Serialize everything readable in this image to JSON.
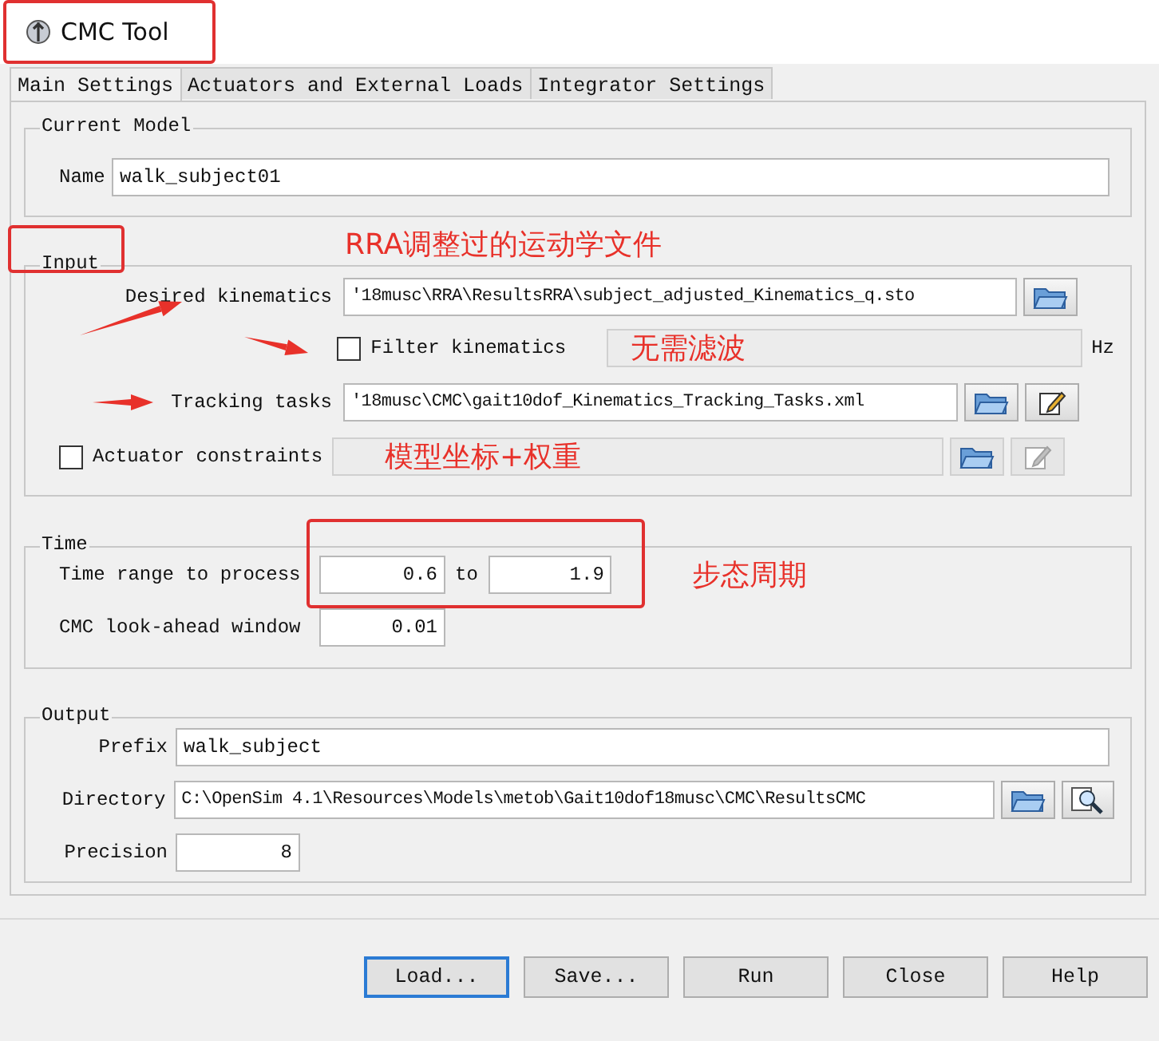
{
  "window": {
    "title": "CMC Tool",
    "highlighted": true
  },
  "tabs": [
    {
      "label": "Main Settings",
      "selected": true
    },
    {
      "label": "Actuators and External Loads",
      "selected": false
    },
    {
      "label": "Integrator Settings",
      "selected": false
    }
  ],
  "current_model": {
    "legend": "Current Model",
    "name_label": "Name",
    "name_value": "walk_subject01"
  },
  "input": {
    "legend": "Input",
    "highlighted": true,
    "note": "RRA调整过的运动学文件",
    "rows": [
      {
        "kind": "file",
        "label": "Desired kinematics",
        "value": "'18musc\\RRA\\ResultsRRA\\subject_adjusted_Kinematics_q.sto",
        "edit_button": false,
        "arrow": true
      },
      {
        "kind": "filter",
        "label": "Filter kinematics",
        "checked": false,
        "note": "无需滤波",
        "unit": "Hz",
        "arrow": true
      },
      {
        "kind": "file",
        "label": "Tracking tasks",
        "value": "'18musc\\CMC\\gait10dof_Kinematics_Tracking_Tasks.xml",
        "edit_button": true,
        "arrow": true
      },
      {
        "kind": "check-file",
        "label": "Actuator constraints",
        "checked": false,
        "disabled": true,
        "note": "模型坐标+权重",
        "arrow": false
      }
    ]
  },
  "time": {
    "legend": "Time",
    "range_label": "Time range to process",
    "start": "0.6",
    "to_label": "to",
    "end": "1.9",
    "highlighted": true,
    "note": "步态周期",
    "lookahead_label": "CMC look-ahead window",
    "lookahead": "0.01"
  },
  "output": {
    "legend": "Output",
    "prefix_label": "Prefix",
    "prefix": "walk_subject",
    "directory_label": "Directory",
    "directory": "C:\\OpenSim 4.1\\Resources\\Models\\metob\\Gait10dof18musc\\CMC\\ResultsCMC",
    "precision_label": "Precision",
    "precision": "8"
  },
  "buttons": [
    {
      "label": "Load...",
      "selected": true
    },
    {
      "label": "Save...",
      "selected": false
    },
    {
      "label": "Run",
      "selected": false
    },
    {
      "label": "Close",
      "selected": false
    },
    {
      "label": "Help",
      "selected": false
    }
  ]
}
